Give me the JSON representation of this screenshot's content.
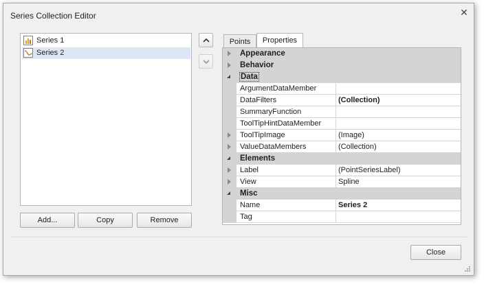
{
  "window": {
    "title": "Series Collection Editor"
  },
  "series_list": [
    {
      "label": "Series 1",
      "icon": "bar-chart-icon",
      "selected": false
    },
    {
      "label": "Series 2",
      "icon": "spline-chart-icon",
      "selected": true
    }
  ],
  "buttons": {
    "add": "Add...",
    "copy": "Copy",
    "remove": "Remove",
    "close": "Close"
  },
  "tabs": [
    {
      "label": "Points",
      "active": false
    },
    {
      "label": "Properties",
      "active": true
    }
  ],
  "properties": [
    {
      "type": "category",
      "name": "Appearance",
      "expanded": false
    },
    {
      "type": "category",
      "name": "Behavior",
      "expanded": false
    },
    {
      "type": "category",
      "name": "Data",
      "expanded": true,
      "focused": true
    },
    {
      "type": "prop",
      "name": "ArgumentDataMember",
      "value": ""
    },
    {
      "type": "prop",
      "name": "DataFilters",
      "value": "(Collection)",
      "bold": true
    },
    {
      "type": "prop",
      "name": "SummaryFunction",
      "value": ""
    },
    {
      "type": "prop",
      "name": "ToolTipHintDataMember",
      "value": ""
    },
    {
      "type": "prop",
      "name": "ToolTipImage",
      "value": "(Image)",
      "expandable": true
    },
    {
      "type": "prop",
      "name": "ValueDataMembers",
      "value": "(Collection)",
      "expandable": true
    },
    {
      "type": "category",
      "name": "Elements",
      "expanded": true
    },
    {
      "type": "prop",
      "name": "Label",
      "value": "(PointSeriesLabel)",
      "expandable": true
    },
    {
      "type": "prop",
      "name": "View",
      "value": "Spline",
      "expandable": true
    },
    {
      "type": "category",
      "name": "Misc",
      "expanded": true
    },
    {
      "type": "prop",
      "name": "Name",
      "value": "Series 2",
      "bold": true
    },
    {
      "type": "prop",
      "name": "Tag",
      "value": ""
    }
  ],
  "colors": {
    "selection": "#dce6f4",
    "category_band": "#d4d4d4",
    "accent_chart": "#e0a020"
  }
}
